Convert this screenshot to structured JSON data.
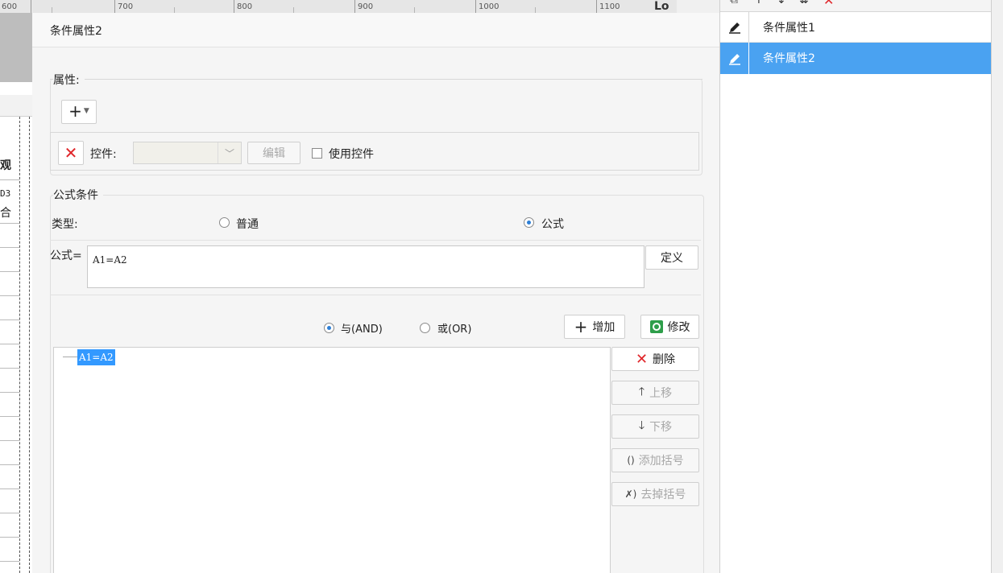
{
  "ruler": {
    "marks": [
      "600",
      "700",
      "800",
      "900",
      "1000",
      "1100"
    ],
    "right_label": "Lo"
  },
  "sheet": {
    "frag_a": "观",
    "frag_b": "D3",
    "frag_c": "合"
  },
  "dialog": {
    "title": "条件属性2",
    "properties": {
      "legend": "属性:",
      "add_button": "+",
      "control_label": "控件:",
      "control_value": "",
      "edit_button": "编辑",
      "use_control_label": "使用控件"
    },
    "formula_condition": {
      "legend": "公式条件",
      "type_label": "类型:",
      "type_options": {
        "normal": "普通",
        "formula": "公式"
      },
      "selected_type": "formula",
      "formula_label": "公式=",
      "formula_value": "A1=A2",
      "define_button": "定义",
      "logic_options": {
        "and": "与(AND)",
        "or": "或(OR)"
      },
      "selected_logic": "and",
      "add_button": "增加",
      "modify_button": "修改"
    },
    "condition_list": {
      "items": [
        "A1=A2"
      ],
      "selected_index": 0
    },
    "side_actions": {
      "delete": "删除",
      "move_up": "上移",
      "move_down": "下移",
      "add_bracket": "添加括号",
      "remove_bracket": "去掉括号"
    }
  },
  "attribute_list": {
    "items": [
      {
        "label": "条件属性1",
        "icon": "pencil-icon"
      },
      {
        "label": "条件属性2",
        "icon": "pencil-icon"
      }
    ],
    "selected_index": 1
  },
  "colors": {
    "accent": "#4aa2f1",
    "radio": "#2d7fd6",
    "danger": "#e0262a"
  }
}
